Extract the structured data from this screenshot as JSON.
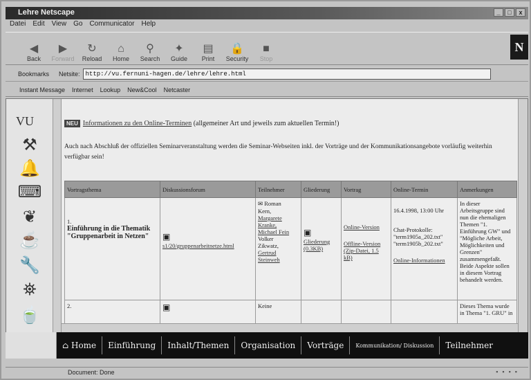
{
  "window": {
    "title": "Lehre Netscape",
    "controls": [
      "_",
      "□",
      "x"
    ]
  },
  "menu": [
    "Datei",
    "Edit",
    "View",
    "Go",
    "Communicator",
    "Help"
  ],
  "toolbar": [
    {
      "label": "Back",
      "icon": "back-icon",
      "glyph": "◀",
      "enabled": true
    },
    {
      "label": "Forward",
      "icon": "forward-icon",
      "glyph": "▶",
      "enabled": false
    },
    {
      "label": "Reload",
      "icon": "reload-icon",
      "glyph": "↻",
      "enabled": true
    },
    {
      "label": "Home",
      "icon": "home-icon",
      "glyph": "⌂",
      "enabled": true
    },
    {
      "label": "Search",
      "icon": "search-icon",
      "glyph": "⚲",
      "enabled": true
    },
    {
      "label": "Guide",
      "icon": "guide-icon",
      "glyph": "✦",
      "enabled": true
    },
    {
      "label": "Print",
      "icon": "print-icon",
      "glyph": "▤",
      "enabled": true
    },
    {
      "label": "Security",
      "icon": "lock-icon",
      "glyph": "🔒",
      "enabled": true
    },
    {
      "label": "Stop",
      "icon": "stop-icon",
      "glyph": "■",
      "enabled": false
    }
  ],
  "logo": "N",
  "location": {
    "bookmarks_label": "Bookmarks",
    "netsite_label": "Netsite:",
    "url": "http://vu.fernuni-hagen.de/lehre/lehre.html"
  },
  "personal_bar": [
    "Instant Message",
    "Internet",
    "Lookup",
    "New&Cool",
    "Netcaster"
  ],
  "left_frame": {
    "logo": "VU",
    "icons": [
      "tools-icon",
      "bells-icon",
      "keyboard-icon",
      "leaf-icon",
      "cup-icon",
      "wrench-icon",
      "lantern-icon",
      "mug-icon"
    ]
  },
  "content": {
    "info_badge": "NEU",
    "info_link": "Informationen zu den Online-Terminen",
    "info_rest": " (allgemeiner Art und jeweils zum aktuellen Termin!)",
    "paragraph": "Auch nach Abschluß der offiziellen Seminarveranstaltung werden die Seminar-Webseiten inkl. der Vorträge und der Kommunikationsangebote vorläufig weiterhin verfügbar sein!",
    "table": {
      "headers": [
        "Vortragsthema",
        "Diskussionsforum",
        "Teilnehmer",
        "Gliederung",
        "Vortrag",
        "Online-Termin",
        "Anmerkungen"
      ],
      "row1": {
        "num": "1.",
        "topic_plain": "Einführung in die Thematik",
        "topic_bold": "\"Gruppenarbeit in Netzen\"",
        "forum_link": "s1/20/gruppenarbeitnetze.html",
        "participants": [
          "Roman",
          "Kern,",
          "Margarete",
          "Kranke,",
          "Michael Fein",
          "Volker",
          "Zikwatz,",
          "Gertrud",
          "Steinweh"
        ],
        "outline_link": "Gliederung (0.3KB)",
        "talk_online": "Online-Version",
        "talk_offline": "Offline-Version (Zip-Datei, 1.5 kB)",
        "term_date": "16.4.1998, 13:00 Uhr",
        "term_detail": "Chat-Protokolle: \"term1905a_202.txt\" \"term1905b_202.txt\"",
        "term_link": "Online-Informationen",
        "remarks": "In dieser Arbeitsgruppe sind nun die ehemaligen Themen \"1. Einführung GW\" und \"Mögliche Arbeit, Möglichkeiten und Grenzen\" zusammengefaßt. Beide Aspekte sollen in diesem Vortrag behandelt werden."
      },
      "row2": {
        "num": "2.",
        "participants": "Keine",
        "remarks": "Dieses Thema wurde in Thema \"1. GRU\" in"
      }
    }
  },
  "nav": [
    "Home",
    "Einführung",
    "Inhalt/Themen",
    "Organisation",
    "Vorträge",
    "Kommunikation/ Diskussion",
    "Teilnehmer"
  ],
  "status": {
    "text": "Document: Done"
  }
}
